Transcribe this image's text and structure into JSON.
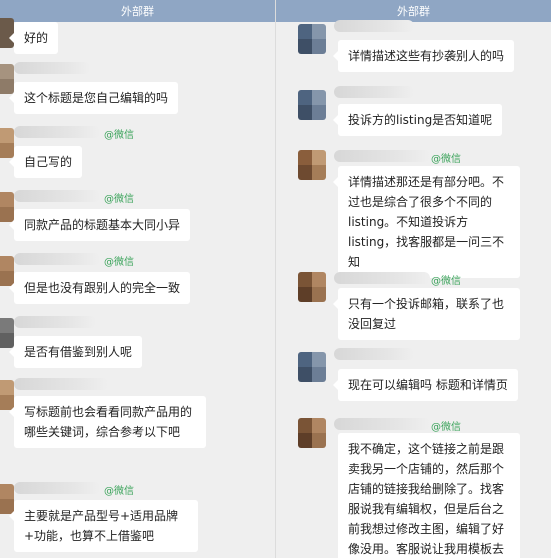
{
  "window": {
    "left_title": "外部群",
    "right_title": "外部群"
  },
  "wechat_tag": "@微信",
  "left_messages": [
    {
      "text": "好的",
      "has_tag": false
    },
    {
      "text": "这个标题是您自己编辑的吗",
      "has_tag": false
    },
    {
      "text": "自己写的",
      "has_tag": true
    },
    {
      "text": "同款产品的标题基本大同小异",
      "has_tag": true
    },
    {
      "text": "但是也没有跟别人的完全一致",
      "has_tag": true
    },
    {
      "text": "是否有借鉴到别人呢",
      "has_tag": false
    },
    {
      "text": "写标题前也会看看同款产品用的哪些关键词，综合参考以下吧",
      "has_tag": false
    },
    {
      "text": "主要就是产品型号+适用品牌+功能，也算不上借鉴吧",
      "has_tag": true
    }
  ],
  "right_messages": [
    {
      "text": "详情描述这些有抄袭别人的吗",
      "has_tag": false
    },
    {
      "text": "投诉方的listing是否知道呢",
      "has_tag": false
    },
    {
      "text": "详情描述那还是有部分吧。不过也是综合了很多个不同的listing。不知道投诉方listing，找客服都是一问三不知",
      "has_tag": true
    },
    {
      "text": "只有一个投诉邮箱，联系了也没回复过",
      "has_tag": true
    },
    {
      "text": "现在可以编辑吗 标题和详情页",
      "has_tag": false
    },
    {
      "text": "我不确定，这个链接之前是跟卖我另一个店铺的，然后那个店铺的链接我给删除了。找客服说我有编辑权，但是后台之前我想过修改主图，编辑了好像没用。客服说让我用模板去",
      "has_tag": true
    }
  ]
}
